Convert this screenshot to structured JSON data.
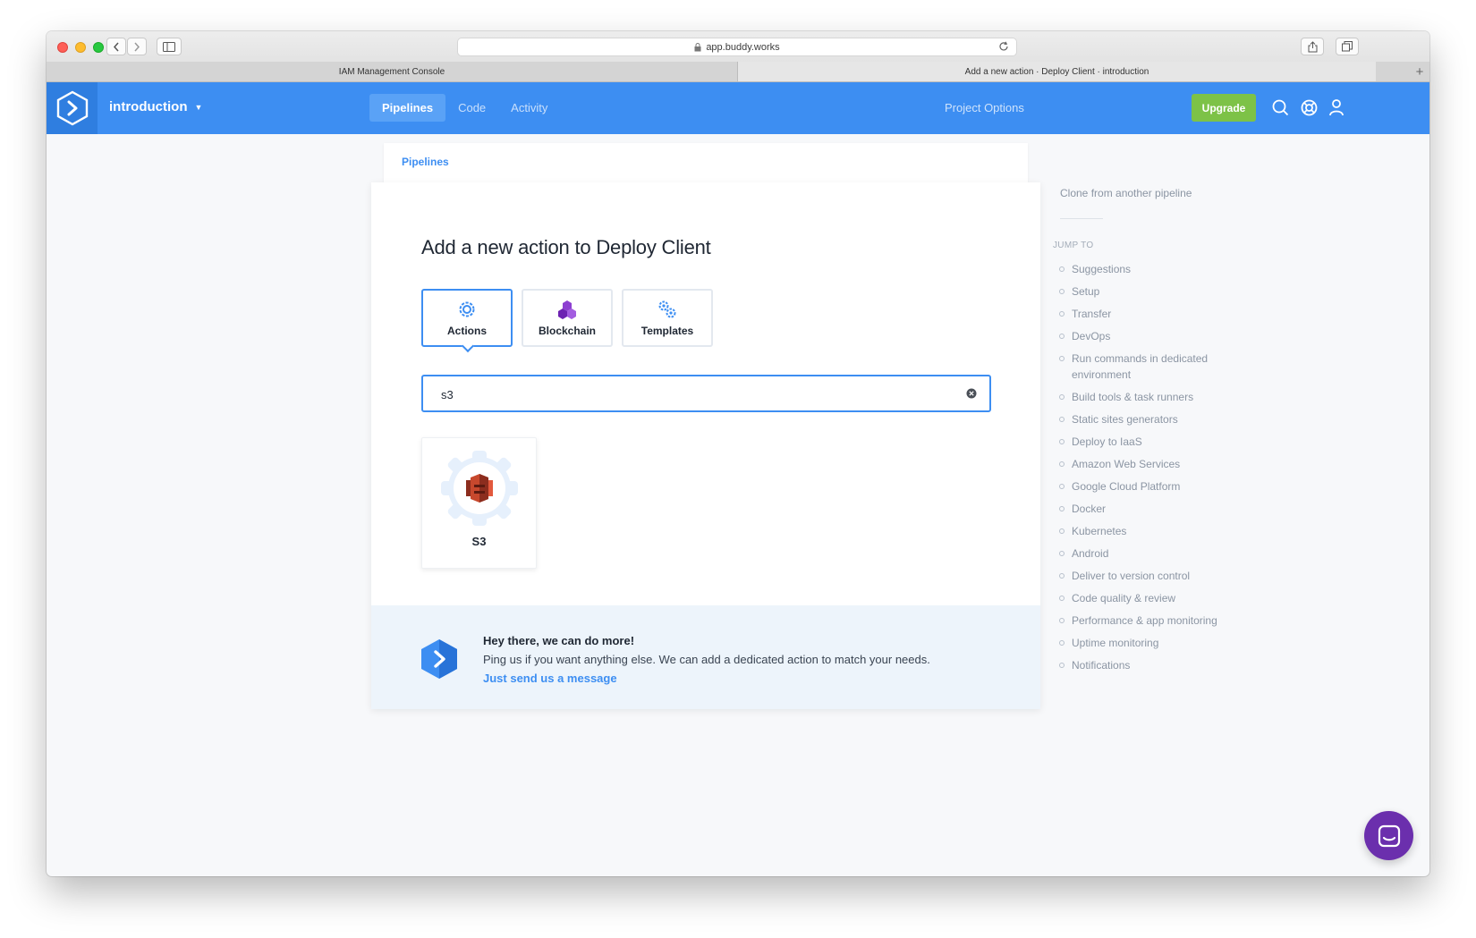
{
  "browser": {
    "url": "app.buddy.works",
    "tabs": [
      {
        "title": "IAM Management Console"
      },
      {
        "title": "Add a new action · Deploy Client · introduction"
      }
    ]
  },
  "header": {
    "project_name": "introduction",
    "nav": [
      {
        "label": "Pipelines",
        "active": true
      },
      {
        "label": "Code"
      },
      {
        "label": "Activity"
      }
    ],
    "project_options": "Project Options",
    "upgrade_label": "Upgrade",
    "icons": [
      "search-icon",
      "help-icon",
      "user-icon"
    ],
    "colors": {
      "header": "#3d8ef2",
      "upgrade": "#7dc247"
    }
  },
  "breadcrumb": {
    "label": "Pipelines"
  },
  "main": {
    "title": "Add a new action to Deploy Client",
    "tabs": [
      {
        "label": "Actions",
        "icon": "gear-icon",
        "active": true
      },
      {
        "label": "Blockchain",
        "icon": "blockchain-icon"
      },
      {
        "label": "Templates",
        "icon": "templates-icon"
      }
    ],
    "search": {
      "value": "s3"
    },
    "results": [
      {
        "label": "S3",
        "icon": "aws-s3-icon"
      }
    ],
    "promo": {
      "heading": "Hey there, we can do more!",
      "text": "Ping us if you want anything else. We can add a dedicated action to match your needs.",
      "link": "Just send us a message"
    }
  },
  "sidebar": {
    "clone": "Clone from another pipeline",
    "jump_to_label": "JUMP TO",
    "items": [
      "Suggestions",
      "Setup",
      "Transfer",
      "DevOps",
      "Run commands in dedicated environment",
      "Build tools & task runners",
      "Static sites generators",
      "Deploy to IaaS",
      "Amazon Web Services",
      "Google Cloud Platform",
      "Docker",
      "Kubernetes",
      "Android",
      "Deliver to version control",
      "Code quality & review",
      "Performance & app monitoring",
      "Uptime monitoring",
      "Notifications"
    ]
  }
}
